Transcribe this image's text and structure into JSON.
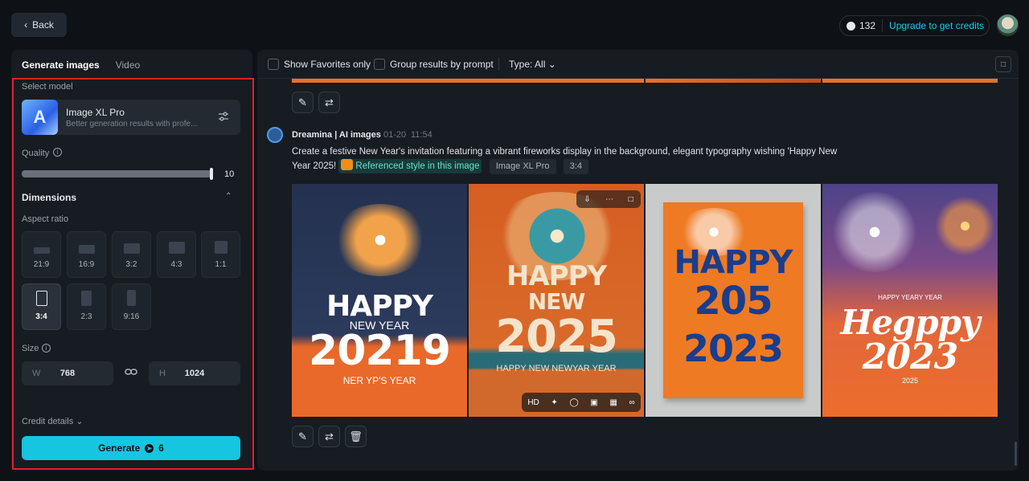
{
  "header": {
    "back_label": "Back",
    "credits_count": "132",
    "upgrade_label": "Upgrade to get credits"
  },
  "left_panel": {
    "tabs": [
      {
        "label": "Generate images"
      },
      {
        "label": "Video"
      }
    ],
    "select_model_label": "Select model",
    "model": {
      "name": "Image XL Pro",
      "description": "Better generation results with profe..."
    },
    "quality_label": "Quality",
    "quality_value": "10",
    "dimensions_label": "Dimensions",
    "aspect_ratio_label": "Aspect ratio",
    "aspect_ratios": [
      {
        "label": "21:9"
      },
      {
        "label": "16:9"
      },
      {
        "label": "3:2"
      },
      {
        "label": "4:3"
      },
      {
        "label": "1:1"
      },
      {
        "label": "3:4"
      },
      {
        "label": "2:3"
      },
      {
        "label": "9:16"
      }
    ],
    "selected_aspect_ratio": "3:4",
    "size_label": "Size",
    "width_prefix": "W",
    "width_value": "768",
    "height_prefix": "H",
    "height_value": "1024",
    "credit_details_label": "Credit details",
    "generate_label": "Generate",
    "generate_cost": "6"
  },
  "main": {
    "filters": {
      "favorites_label": "Show Favorites only",
      "group_label": "Group results by prompt",
      "type_label": "Type: All"
    },
    "entry": {
      "author": "Dreamina | AI images",
      "date": "01-20",
      "time": "11:54",
      "prompt_text": "Create a festive New Year's invitation featuring a vibrant fireworks display in the background, elegant typography wishing 'Happy New Year 2025!",
      "ref_label": "Referenced style in this image",
      "model_tag": "Image XL Pro",
      "ratio_tag": "3:4"
    },
    "images": [
      {
        "line1": "HAPPY",
        "line2": "NEW YEAR",
        "line3": "20219",
        "line4": "NER YP'S YEAR"
      },
      {
        "line1": "HAPPY",
        "line2": "NEW",
        "line3": "2025",
        "line4": "HAPPY NEW NEWYAR YEAR"
      },
      {
        "line1": "HAPPY",
        "line2": "205",
        "line3": "2023",
        "line4": ""
      },
      {
        "line1": "HAPPY YEARY YEAR",
        "line2": "Hegppy",
        "line3": "2023",
        "line4": "2025"
      }
    ],
    "hover_tools": {
      "hd_label": "HD"
    }
  },
  "colors": {
    "accent": "#16c5e0",
    "highlight_border": "#e21f2a",
    "panel": "#171c22",
    "background": "#0e1216"
  }
}
